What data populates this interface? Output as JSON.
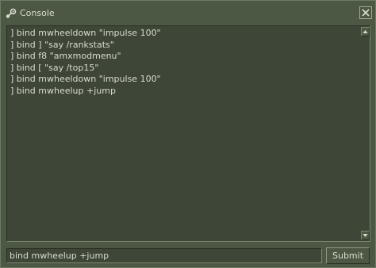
{
  "window": {
    "title": "Console",
    "title_icon": "steam-logo-icon",
    "close_icon": "close-icon"
  },
  "log": {
    "lines": [
      "] bind mwheeldown \"impulse 100\"",
      "] bind ] \"say /rankstats\"",
      "] bind f8 \"amxmodmenu\"",
      "] bind [ \"say /top15\"",
      "] bind mwheeldown \"impulse 100\"",
      "] bind mwheelup +jump"
    ]
  },
  "scrollbar": {
    "up_icon": "arrow-up-icon",
    "down_icon": "arrow-down-icon"
  },
  "command": {
    "value": "bind mwheelup +jump",
    "submit_label": "Submit"
  },
  "colors": {
    "window_bg": "#4c5844",
    "panel_bg": "#3e4637",
    "text": "#d8dcd0"
  }
}
